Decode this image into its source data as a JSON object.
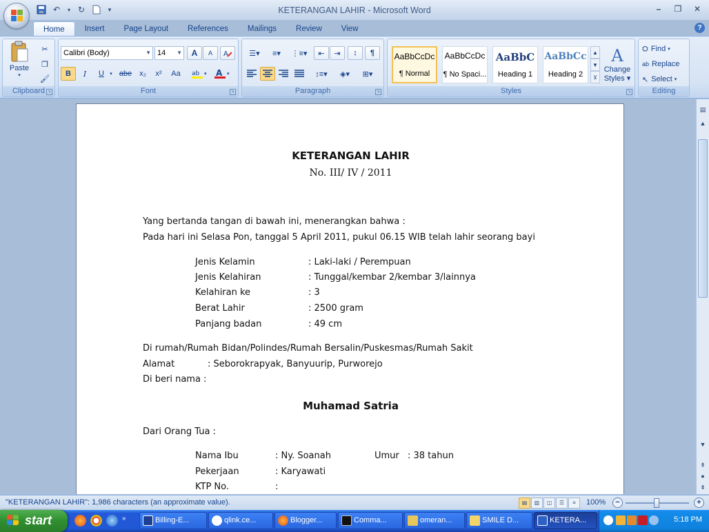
{
  "window": {
    "title": "KETERANGAN LAHIR - Microsoft Word",
    "controls": {
      "minimize": "–",
      "restore": "❐",
      "close": "✕"
    }
  },
  "qat": {
    "save_icon": "save-icon",
    "undo_icon": "undo-icon",
    "redo_icon": "redo-icon",
    "new_icon": "new-document-icon"
  },
  "tabs": [
    "Home",
    "Insert",
    "Page Layout",
    "References",
    "Mailings",
    "Review",
    "View"
  ],
  "active_tab": "Home",
  "ribbon": {
    "clipboard": {
      "label": "Clipboard",
      "paste": "Paste"
    },
    "font": {
      "label": "Font",
      "family": "Calibri (Body)",
      "size": "14",
      "bold": "B",
      "italic": "I",
      "underline": "U",
      "strike": "abe",
      "subscript": "x₂",
      "superscript": "x²",
      "case": "Aa",
      "grow": "A",
      "shrink": "A"
    },
    "paragraph": {
      "label": "Paragraph",
      "pilcrow": "¶"
    },
    "styles": {
      "label": "Styles",
      "items": [
        {
          "sample": "AaBbCcDc",
          "name": "¶ Normal"
        },
        {
          "sample": "AaBbCcDc",
          "name": "¶ No Spaci..."
        },
        {
          "sample": "AaBbC",
          "name": "Heading 1"
        },
        {
          "sample": "AaBbCc",
          "name": "Heading 2"
        }
      ],
      "change_styles_line1": "Change",
      "change_styles_line2": "Styles"
    },
    "editing": {
      "label": "Editing",
      "find": "Find",
      "replace": "Replace",
      "select": "Select"
    }
  },
  "document": {
    "title": "KETERANGAN LAHIR",
    "number": "No. III/ IV / 2011",
    "intro1": "Yang bertanda tangan di bawah ini, menerangkan bahwa :",
    "intro2": "Pada hari ini Selasa Pon, tanggal 5 April 2011, pukul 06.15 WIB telah lahir seorang bayi",
    "details": [
      {
        "label": "Jenis Kelamin",
        "value": ": Laki-laki / Perempuan"
      },
      {
        "label": "Jenis Kelahiran",
        "value": ": Tunggal/kembar 2/kembar 3/lainnya"
      },
      {
        "label": "Kelahiran ke",
        "value": ": 3"
      },
      {
        "label": "Berat Lahir",
        "value": ": 2500 gram"
      },
      {
        "label": "Panjang badan",
        "value": ": 49 cm"
      }
    ],
    "place": "Di rumah/Rumah Bidan/Polindes/Rumah Bersalin/Puskesmas/Rumah Sakit",
    "address_label": "Alamat",
    "address_value": ": Seborokrapyak, Banyuurip, Purworejo",
    "named": "Di beri nama :",
    "baby_name": "Muhamad Satria",
    "parents": "Dari Orang Tua :",
    "mother": [
      {
        "label": "Nama Ibu",
        "value": ": Ny. Soanah"
      },
      {
        "label": "Pekerjaan",
        "value": ": Karyawati"
      },
      {
        "label": "KTP No.",
        "value": ":"
      }
    ],
    "age_label": "Umur",
    "age_value": ": 38 tahun"
  },
  "status": {
    "text": "\"KETERANGAN LAHIR\": 1,986 characters (an approximate value).",
    "zoom": "100%",
    "minus": "−",
    "plus": "+"
  },
  "taskbar": {
    "start": "start",
    "tasks": [
      "Billing-E...",
      "qlink.ce...",
      "Blogger...",
      "Comma...",
      "omeran...",
      "SMILE D...",
      "KETERA..."
    ],
    "clock": "5:18 PM",
    "colors": {
      "start_green": "#2f8f2f",
      "taskbar_blue": "#2358d6",
      "tray_blue": "#128be8"
    }
  }
}
